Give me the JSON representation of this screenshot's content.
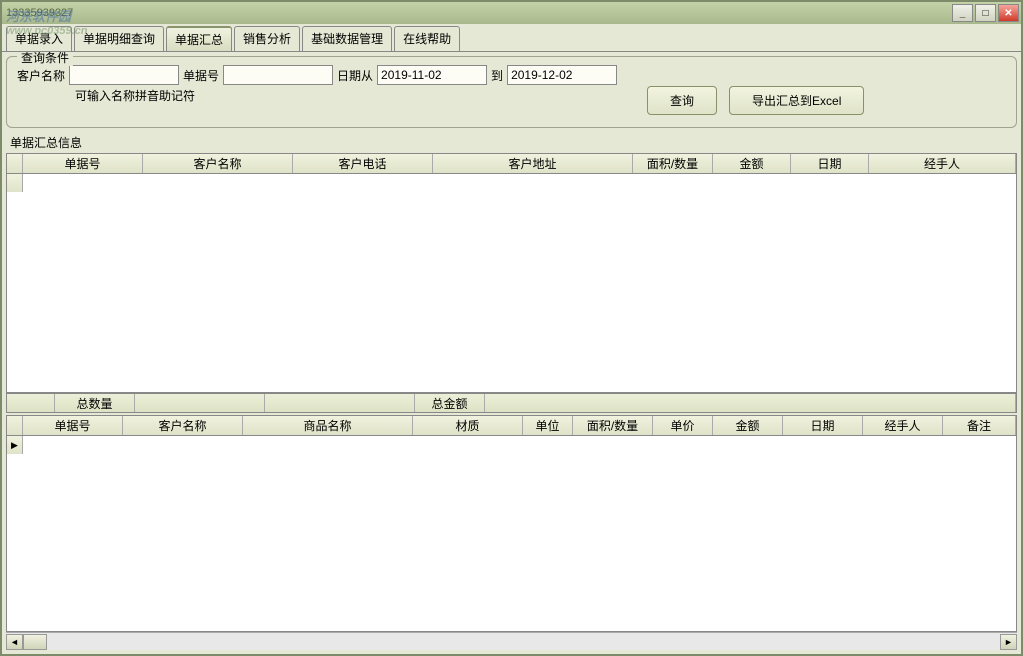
{
  "title": "13335939327",
  "watermark": {
    "line1": "河东软件园",
    "line2": "www.pc0359.cn"
  },
  "tabs": [
    {
      "label": "单据录入"
    },
    {
      "label": "单据明细查询"
    },
    {
      "label": "单据汇总"
    },
    {
      "label": "销售分析"
    },
    {
      "label": "基础数据管理"
    },
    {
      "label": "在线帮助"
    }
  ],
  "query": {
    "legend": "查询条件",
    "customer_label": "客户名称",
    "customer_value": "",
    "docno_label": "单据号",
    "docno_value": "",
    "date_from_label": "日期从",
    "date_from_value": "2019-11-02",
    "date_to_label": "到",
    "date_to_value": "2019-12-02",
    "hint": "可输入名称拼音助记符",
    "search_btn": "查询",
    "export_btn": "导出汇总到Excel"
  },
  "grid1": {
    "section_label": "单据汇总信息",
    "cols": [
      "单据号",
      "客户名称",
      "客户电话",
      "客户地址",
      "面积/数量",
      "金额",
      "日期",
      "经手人"
    ]
  },
  "summary": {
    "total_qty_label": "总数量",
    "total_qty_value": "",
    "total_amt_label": "总金额",
    "total_amt_value": ""
  },
  "grid2": {
    "cols": [
      "单据号",
      "客户名称",
      "商品名称",
      "材质",
      "单位",
      "面积/数量",
      "单价",
      "金额",
      "日期",
      "经手人",
      "备注"
    ]
  }
}
